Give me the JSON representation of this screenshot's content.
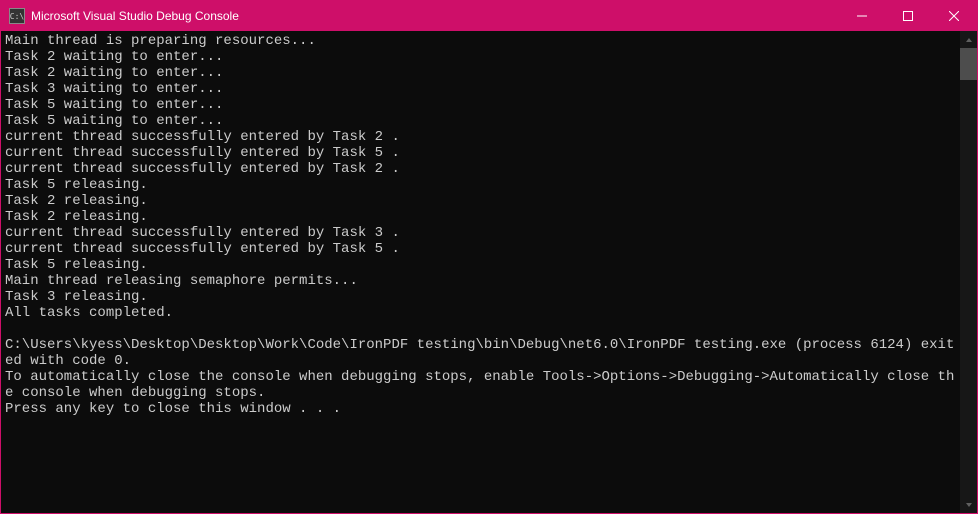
{
  "window": {
    "title": "Microsoft Visual Studio Debug Console",
    "icon_text": "C:\\"
  },
  "console": {
    "lines": [
      "Main thread is preparing resources...",
      "Task 2 waiting to enter...",
      "Task 2 waiting to enter...",
      "Task 3 waiting to enter...",
      "Task 5 waiting to enter...",
      "Task 5 waiting to enter...",
      "current thread successfully entered by Task 2 .",
      "current thread successfully entered by Task 5 .",
      "current thread successfully entered by Task 2 .",
      "Task 5 releasing.",
      "Task 2 releasing.",
      "Task 2 releasing.",
      "current thread successfully entered by Task 3 .",
      "current thread successfully entered by Task 5 .",
      "Task 5 releasing.",
      "Main thread releasing semaphore permits...",
      "Task 3 releasing.",
      "All tasks completed.",
      "",
      "C:\\Users\\kyess\\Desktop\\Desktop\\Work\\Code\\IronPDF testing\\bin\\Debug\\net6.0\\IronPDF testing.exe (process 6124) exited with code 0.",
      "To automatically close the console when debugging stops, enable Tools->Options->Debugging->Automatically close the console when debugging stops.",
      "Press any key to close this window . . ."
    ]
  }
}
